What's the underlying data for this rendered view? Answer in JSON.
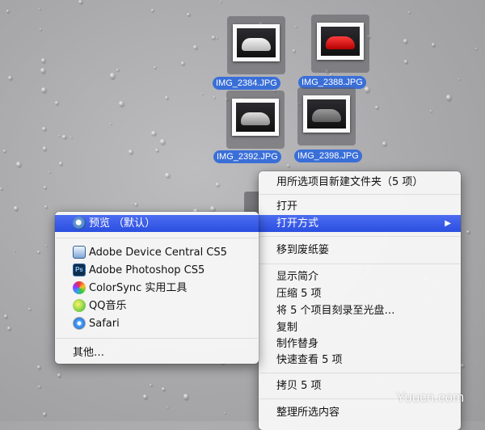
{
  "files": [
    {
      "name": "IMG_2384.JPG",
      "car": "white"
    },
    {
      "name": "IMG_2388.JPG",
      "car": "red"
    },
    {
      "name": "IMG_2392.JPG",
      "car": "silver"
    },
    {
      "name": "IMG_2398.JPG",
      "car": "grey"
    }
  ],
  "context_menu": {
    "new_folder_with_selection": "用所选项目新建文件夹（5 项）",
    "open": "打开",
    "open_with": "打开方式",
    "move_to_trash": "移到废纸篓",
    "get_info": "显示简介",
    "compress": "压缩 5 项",
    "burn_to_disc": "将 5 个项目刻录至光盘…",
    "duplicate": "复制",
    "make_alias": "制作替身",
    "quick_look": "快速查看 5 项",
    "copy": "拷贝 5 项",
    "clean_up_selection": "整理所选内容"
  },
  "open_with_menu": {
    "preview_default": "预览 （默认）",
    "apps": [
      {
        "label": "Adobe Device Central CS5",
        "icon": "adobe-device-central-icon"
      },
      {
        "label": "Adobe Photoshop CS5",
        "icon": "photoshop-icon",
        "icon_text": "Ps"
      },
      {
        "label": "ColorSync 实用工具",
        "icon": "colorsync-icon"
      },
      {
        "label": "QQ音乐",
        "icon": "qq-music-icon"
      },
      {
        "label": "Safari",
        "icon": "safari-icon"
      }
    ],
    "other": "其他…"
  },
  "watermark": "Yuucn.com",
  "colors": {
    "selection": "#2a4ee0",
    "label_highlight": "#3a6fd8"
  }
}
